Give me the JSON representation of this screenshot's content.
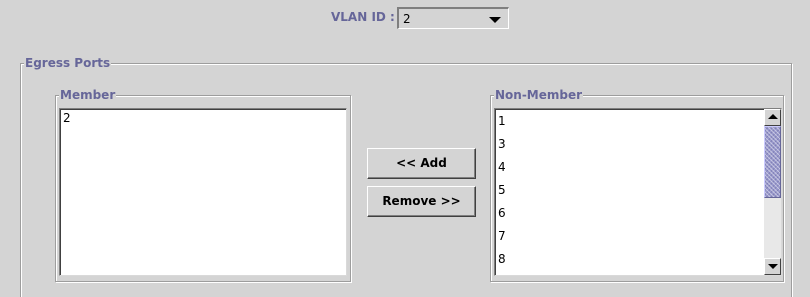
{
  "vlan": {
    "label": "VLAN ID :",
    "selected_value": "2"
  },
  "egress": {
    "legend": "Egress Ports"
  },
  "member": {
    "legend": "Member",
    "items": [
      "2"
    ]
  },
  "non_member": {
    "legend": "Non-Member",
    "items": [
      "1",
      "3",
      "4",
      "5",
      "6",
      "7",
      "8"
    ],
    "scroll_position": 0.0
  },
  "buttons": {
    "add_label": "<< Add",
    "remove_label": "Remove >>"
  },
  "icons": {
    "vlan_dropdown": "chevron-down-icon",
    "scroll_up": "arrow-up-icon",
    "scroll_down": "arrow-down-icon"
  },
  "colors": {
    "background": "#d4d4d4",
    "label_text": "#666699",
    "scroll_thumb": "#9999cc"
  }
}
